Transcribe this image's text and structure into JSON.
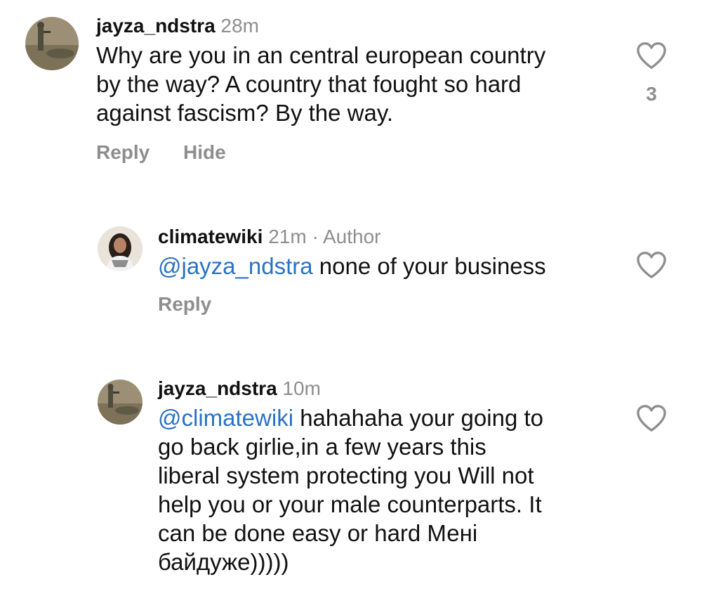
{
  "icons": {
    "like": "heart-outline-icon"
  },
  "colors": {
    "mention": "#2a72c4",
    "secondary_text": "#8e8e8e",
    "primary_text": "#111111"
  },
  "comments": [
    {
      "username": "jayza_ndstra",
      "time": "28m",
      "text_lines": [
        "Why are you in an central european country",
        "by the way? A country that fought so hard",
        "against fascism? By the way."
      ],
      "like_count": "3",
      "actions": {
        "reply": "Reply",
        "hide": "Hide"
      }
    },
    {
      "username": "climatewiki",
      "time": "21m",
      "separator": "·",
      "badge": "Author",
      "mention": "@jayza_ndstra",
      "text": " none of your business",
      "actions": {
        "reply": "Reply"
      }
    },
    {
      "username": "jayza_ndstra",
      "time": "10m",
      "mention": "@climatewiki",
      "first_line_rest": " hahahaha your going to",
      "text_lines": [
        "go back girlie,in a few years this",
        "liberal system protecting you Will not",
        "help you or your male counterparts. It",
        "can be done easy or hard Мені",
        "байдуже)))))"
      ]
    }
  ]
}
